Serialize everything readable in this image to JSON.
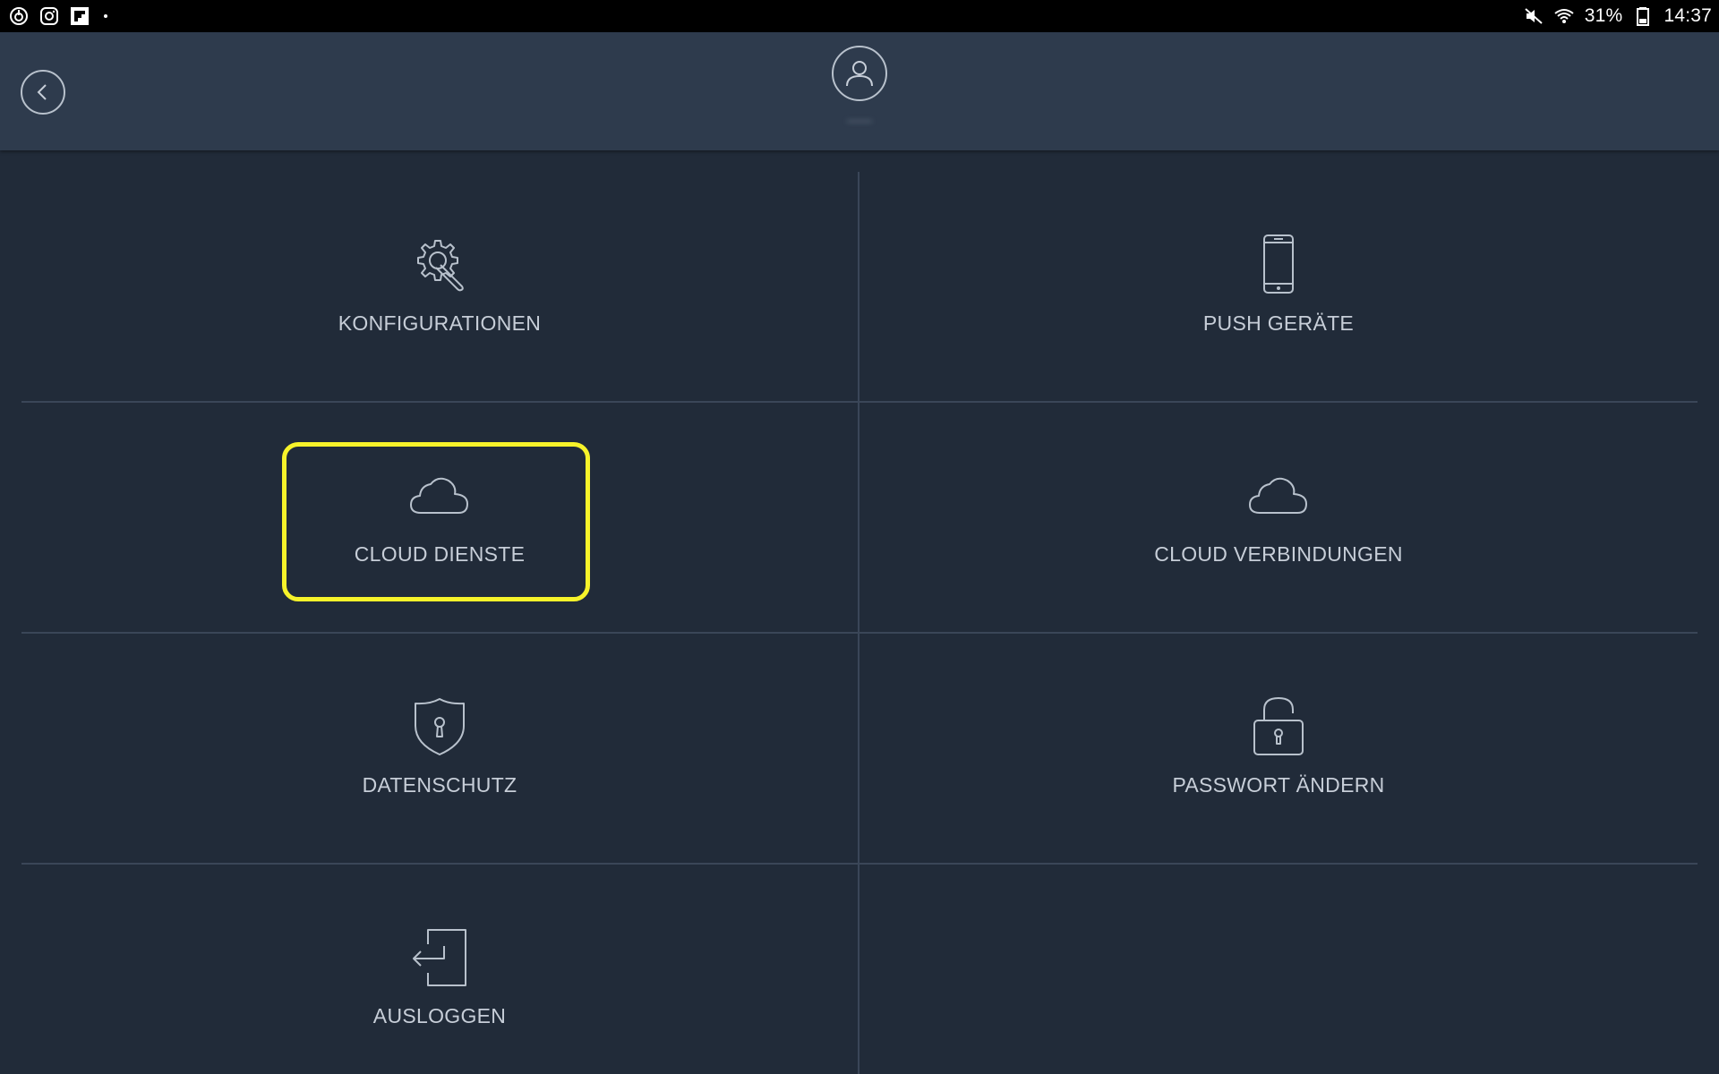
{
  "status_bar": {
    "battery": "31%",
    "time": "14:37",
    "left_icons": [
      "power-icon",
      "instagram-icon",
      "flipboard-icon"
    ],
    "right_icons": [
      "mute-icon",
      "wifi-icon",
      "battery-icon"
    ]
  },
  "header": {
    "username": "——"
  },
  "menu": {
    "items": [
      {
        "label": "KONFIGURATIONEN",
        "icon": "gear-wrench-icon"
      },
      {
        "label": "PUSH GERÄTE",
        "icon": "smartphone-icon"
      },
      {
        "label": "CLOUD DIENSTE",
        "icon": "cloud-icon"
      },
      {
        "label": "CLOUD VERBINDUNGEN",
        "icon": "cloud-icon"
      },
      {
        "label": "DATENSCHUTZ",
        "icon": "shield-lock-icon"
      },
      {
        "label": "PASSWORT ÄNDERN",
        "icon": "padlock-icon"
      },
      {
        "label": "AUSLOGGEN",
        "icon": "logout-icon"
      }
    ]
  },
  "colors": {
    "background": "#212b39",
    "header": "#2e3b4d",
    "divider": "#3a4658",
    "label": "#c7ced8",
    "icon_stroke": "#b8c1cc",
    "highlight": "#f7f32a"
  }
}
